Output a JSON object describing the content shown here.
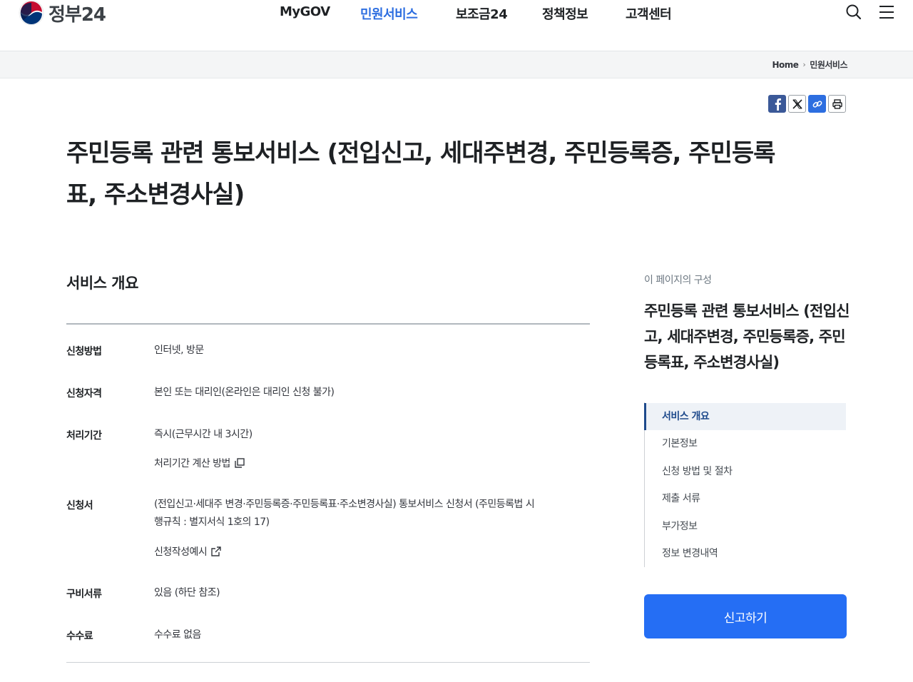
{
  "brand": {
    "name": "정부24"
  },
  "nav": {
    "items": [
      {
        "label": "MyGOV"
      },
      {
        "label": "민원서비스"
      },
      {
        "label": "보조금24"
      },
      {
        "label": "정책정보"
      },
      {
        "label": "고객센터"
      }
    ],
    "active_color": "#2d6ee0",
    "search_icon": "search-icon",
    "menu_icon": "hamburger-menu-icon"
  },
  "breadcrumb": {
    "home": "Home",
    "current": "민원서비스"
  },
  "share": {
    "icons": [
      "facebook-icon",
      "x-twitter-icon",
      "link-icon",
      "print-icon"
    ]
  },
  "page": {
    "title_line1": "주민등록 관련 통보서비스 (전입신고, 세대주변경, 주민등록증, 주민등록",
    "title_line2": "표, 주소변경사실)"
  },
  "overview": {
    "title": "서비스 개요",
    "rows": {
      "method": {
        "label": "신청방법",
        "value": "인터넷, 방문"
      },
      "eligibility": {
        "label": "신청자격",
        "value": "본인 또는 대리인(온라인은 대리인 신청 불가)"
      },
      "period": {
        "label": "처리기간",
        "value": "즉시(근무시간 내 3시간)",
        "link": "처리기간 계산 방법"
      },
      "form": {
        "label": "신청서",
        "value_line1": "(전입신고·세대주 변경·주민등록증·주민등록표·주소변경사실) 통보서비스 신청서 (주민등록법 시",
        "value_line2": "행규칙 : 별지서식 1호의 17)",
        "link": "신청작성예시"
      },
      "documents": {
        "label": "구비서류",
        "value": "있음 (하단 참조)"
      },
      "fee": {
        "label": "수수료",
        "value": "수수료 없음"
      }
    }
  },
  "toc": {
    "caption": "이 페이지의 구성",
    "title": "주민등록 관련 통보서비스 (전입신고, 세대주변경, 주민등록증, 주민등록표, 주소변경사실)",
    "items": [
      {
        "label": "서비스 개요"
      },
      {
        "label": "기본정보"
      },
      {
        "label": "신청 방법 및 절차"
      },
      {
        "label": "제출 서류"
      },
      {
        "label": "부가정보"
      },
      {
        "label": "정보 변경내역"
      }
    ]
  },
  "cta": {
    "label": "신고하기",
    "color": "#256ef4"
  }
}
